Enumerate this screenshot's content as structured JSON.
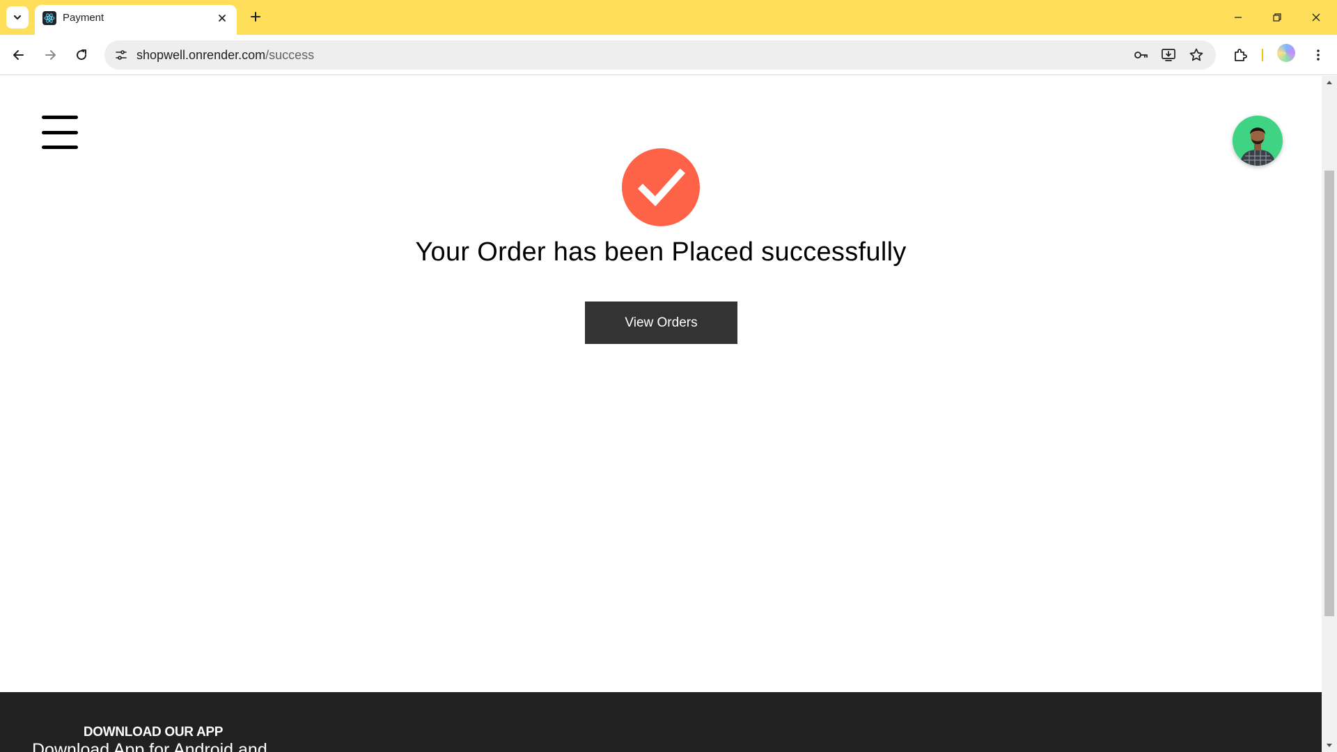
{
  "browser": {
    "tab": {
      "title": "Payment",
      "favicon": "react-logo-icon"
    },
    "url": {
      "host": "shopwell.onrender.com",
      "path": "/success"
    },
    "theme_color": "#ffde5a"
  },
  "page": {
    "menu_icon": "hamburger-menu-icon",
    "avatar_bg": "#3fd483",
    "success": {
      "icon": "check-icon",
      "icon_color": "#ff6347",
      "message": "Your Order has been Placed successfully",
      "button_label": "View Orders"
    },
    "footer": {
      "heading": "DOWNLOAD OUR APP",
      "subtext": "Download App for Android and"
    }
  }
}
